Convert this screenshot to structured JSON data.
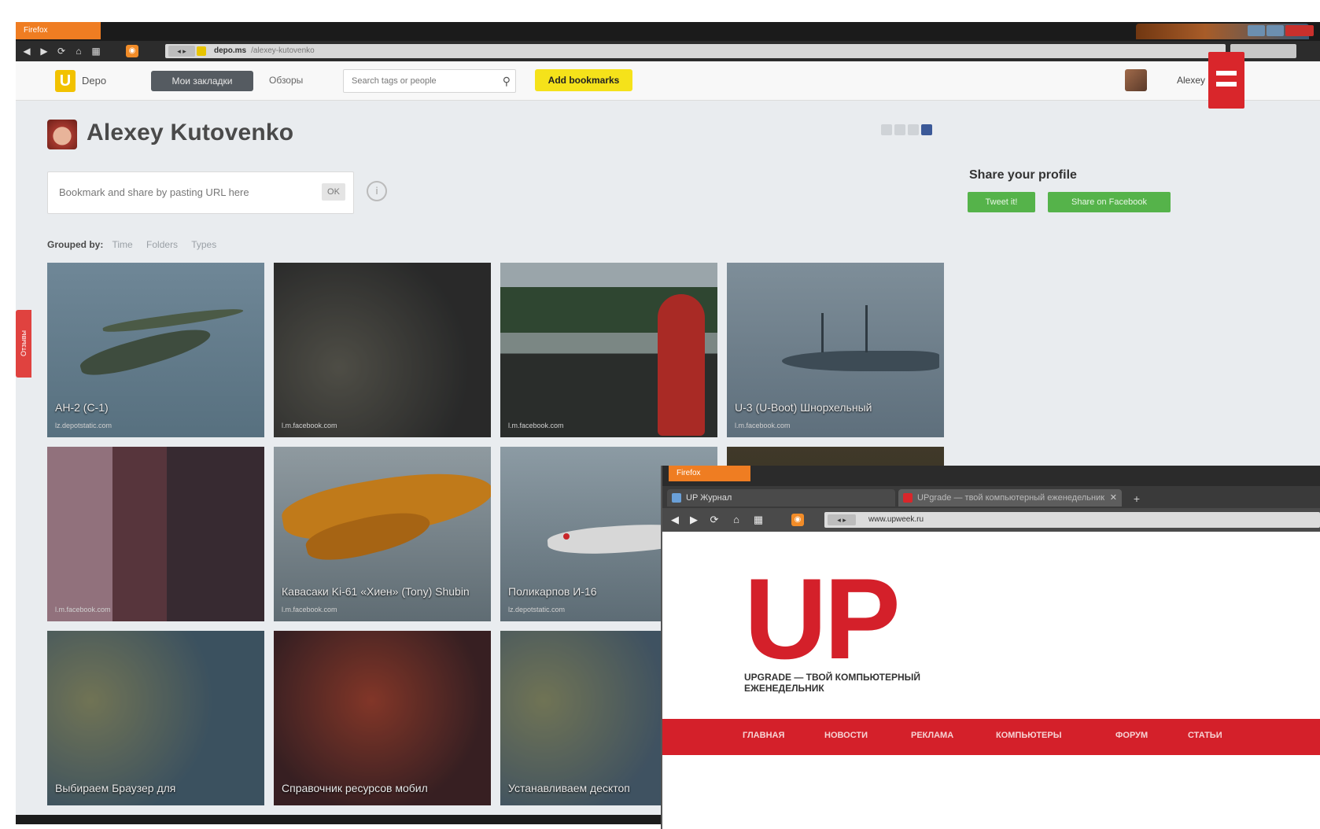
{
  "main_window": {
    "browser_badge": "Firefox",
    "address": {
      "nav": "◂ ▸",
      "url": "depo.ms",
      "rest": "/alexey-kutovenko"
    },
    "header": {
      "logo_letter": "U",
      "logo_text": "Depo",
      "nav_active": "Мои закладки",
      "nav_link": "Обзоры",
      "search_placeholder": "Search tags or people",
      "add_button": "Add bookmarks",
      "user_name": "Alexey"
    },
    "profile": {
      "name": "Alexey Kutovenko",
      "bookmark_input": "Bookmark and share by pasting URL here",
      "bookmark_go": "OK",
      "info_icon": "i",
      "grouped_label": "Grouped by:",
      "grouped_options": [
        "Time",
        "Folders",
        "Types"
      ]
    },
    "share": {
      "title": "Share your profile",
      "twitter_button": "Tweet it!",
      "facebook_button": "Share on Facebook"
    },
    "side_tab": "Отзывы",
    "tiles": [
      {
        "caption": "АН-2 (С-1)",
        "source": "lz.depotstatic.com"
      },
      {
        "caption": "",
        "source": "l.m.facebook.com"
      },
      {
        "caption": "",
        "source": "l.m.facebook.com"
      },
      {
        "caption": "U-3 (U-Boot) Шнорхельный",
        "source": "l.m.facebook.com"
      },
      {
        "caption": "",
        "source": "l.m.facebook.com"
      },
      {
        "caption": "Кавасаки Ki-61 «Хиен» (Tony) Shubin",
        "source": "l.m.facebook.com"
      },
      {
        "caption": "Поликарпов И-16",
        "source": "lz.depotstatic.com"
      },
      {
        "caption": "",
        "source": ""
      },
      {
        "caption": "Выбираем Браузер для",
        "source": ""
      },
      {
        "caption": "Справочник ресурсов мобил",
        "source": ""
      },
      {
        "caption": "Устанавливаем десктоп",
        "source": ""
      }
    ]
  },
  "up_window": {
    "browser_badge": "Firefox",
    "tabs": [
      {
        "label": "UP Журнал"
      },
      {
        "label": "UPgrade — твой компьютерный еженедельник"
      }
    ],
    "new_tab": "+",
    "address": {
      "nav": "◂ ▸",
      "url": "www.upweek.ru"
    },
    "logo": "UP",
    "tagline": "UPGRADE — ТВОЙ КОМПЬЮТЕРНЫЙ ЕЖЕНЕДЕЛЬНИК",
    "nav": [
      "ГЛАВНАЯ",
      "НОВОСТИ",
      "РЕКЛАМА",
      "КОМПЬЮТЕРЫ",
      "ФОРУМ",
      "СТАТЬИ"
    ]
  },
  "colors": {
    "accent_orange": "#ef7d22",
    "add_button": "#f5e21a",
    "share_green": "#55b34a",
    "up_red": "#d4202a"
  },
  "icons": [
    "back-icon",
    "forward-icon",
    "reload-icon",
    "home-icon",
    "rss-icon",
    "search-icon",
    "info-icon",
    "facebook-icon",
    "close-icon"
  ]
}
